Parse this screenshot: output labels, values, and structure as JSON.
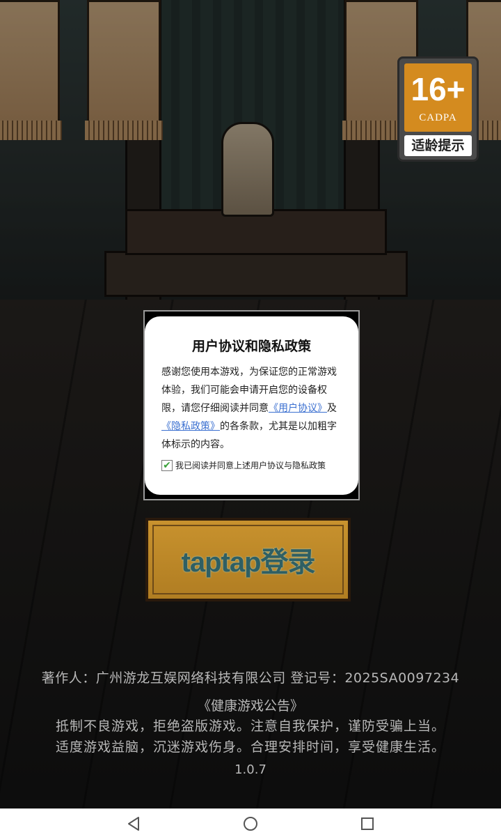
{
  "age_rating": {
    "age": "16+",
    "org": "CADPA",
    "label": "适龄提示"
  },
  "dialog": {
    "title": "用户协议和隐私政策",
    "body_text_1": "感谢您使用本游戏，为保证您的正常游戏体验，我们可能会申请开启您的设备权限，请您仔细阅读并同意",
    "user_agreement_link": "《用户协议》",
    "and_text": "及",
    "privacy_policy_link": "《隐私政策》",
    "body_text_2": "的各条款，尤其是以加粗字体标示的内容。",
    "agree_checkbox_label": "我已阅读并同意上述用户协议与隐私政策",
    "agree_checked": true
  },
  "login_button_label": "taptap登录",
  "footer": {
    "credit": "著作人：广州游龙互娱网络科技有限公司 登记号：2025SA0097234",
    "notice_title": "《健康游戏公告》",
    "notice_line1": "抵制不良游戏，拒绝盗版游戏。注意自我保护，谨防受骗上当。",
    "notice_line2": "适度游戏益脑，沉迷游戏伤身。合理安排时间，享受健康生活。",
    "version": "1.0.7"
  },
  "navbar": {
    "back_icon": "back-triangle-icon",
    "home_icon": "home-circle-icon",
    "recent_icon": "recent-square-icon"
  },
  "colors": {
    "rating_orange": "#d48b1f",
    "link_blue": "#3a6fd0",
    "button_gold": "#c8922e",
    "button_text_teal": "#2f5f63"
  }
}
